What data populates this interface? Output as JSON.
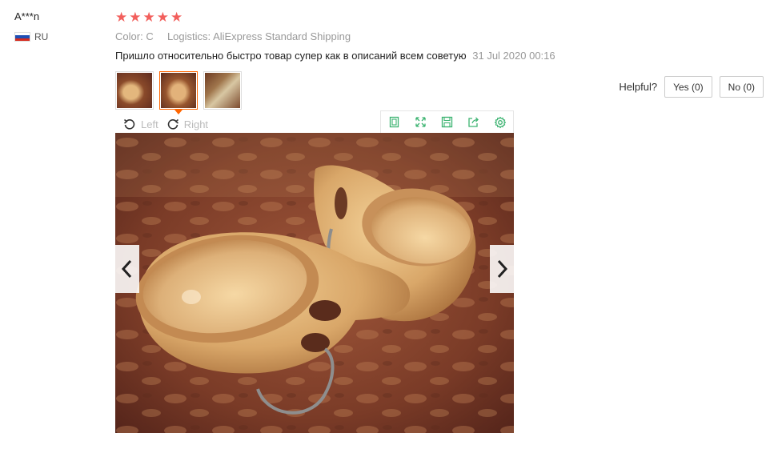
{
  "user": {
    "name": "A***n",
    "country": "RU"
  },
  "rating": {
    "stars": 5,
    "max": 5
  },
  "meta": {
    "color_label": "Color:",
    "color_value": "C",
    "logistics_label": "Logistics:",
    "logistics_value": "AliExpress Standard Shipping"
  },
  "review": {
    "text": "Пришло относительно быстро товар супер как в описаний всем советую",
    "date": "31 Jul 2020 00:16"
  },
  "thumbnails": {
    "count": 3,
    "active_index": 1
  },
  "helpful": {
    "label": "Helpful?",
    "yes_label": "Yes (0)",
    "no_label": "No (0)"
  },
  "viewer": {
    "rotate_left": "Left",
    "rotate_right": "Right",
    "tools": [
      "fit-screen-icon",
      "fullscreen-icon",
      "save-icon",
      "share-icon",
      "settings-icon"
    ]
  },
  "colors": {
    "star": "#f25f5c",
    "accent": "#f60",
    "tool_icon": "#3cb371"
  }
}
